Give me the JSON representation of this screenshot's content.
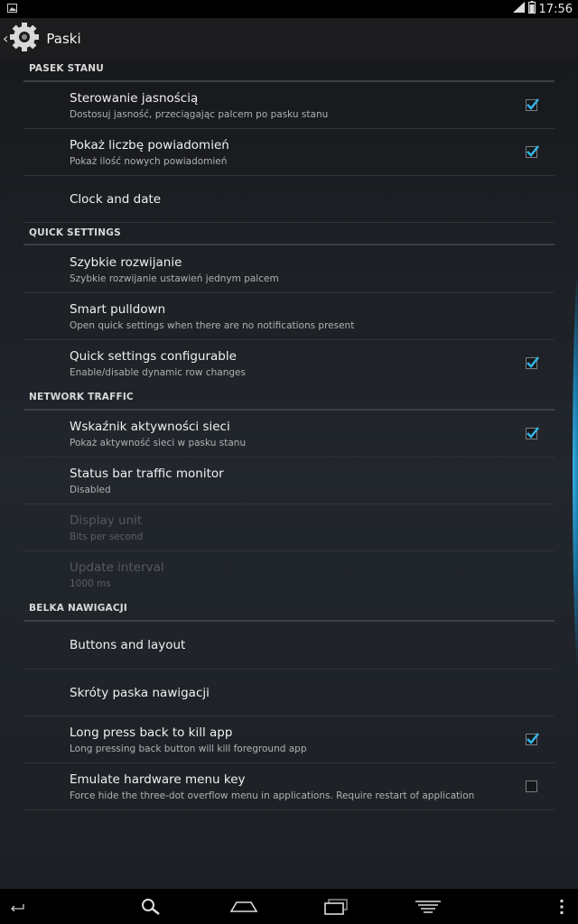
{
  "status_bar": {
    "time": "17:56"
  },
  "action_bar": {
    "title": "Paski"
  },
  "sections": [
    {
      "header": "PASEK STANU",
      "items": [
        {
          "title": "Sterowanie jasnością",
          "summary": "Dostosuj jasność, przeciągając palcem po pasku stanu",
          "checkbox": true,
          "checked": true
        },
        {
          "title": "Pokaż liczbę powiadomień",
          "summary": "Pokaż ilość nowych powiadomień",
          "checkbox": true,
          "checked": true
        },
        {
          "title": "Clock and date"
        }
      ]
    },
    {
      "header": "QUICK SETTINGS",
      "items": [
        {
          "title": "Szybkie rozwijanie",
          "summary": "Szybkie rozwijanie ustawień jednym palcem"
        },
        {
          "title": "Smart pulldown",
          "summary": "Open quick settings when there are no notifications present"
        },
        {
          "title": "Quick settings configurable",
          "summary": "Enable/disable dynamic row changes",
          "checkbox": true,
          "checked": true
        }
      ]
    },
    {
      "header": "NETWORK TRAFFIC",
      "items": [
        {
          "title": "Wskaźnik aktywności sieci",
          "summary": "Pokaż aktywność sieci w pasku stanu",
          "checkbox": true,
          "checked": true
        },
        {
          "title": "Status bar traffic monitor",
          "summary": "Disabled"
        },
        {
          "title": "Display unit",
          "summary": "Bits per second",
          "disabled": true
        },
        {
          "title": "Update interval",
          "summary": "1000 ms",
          "disabled": true
        }
      ]
    },
    {
      "header": "BELKA NAWIGACJI",
      "items": [
        {
          "title": "Buttons and layout"
        },
        {
          "title": "Skróty paska nawigacji"
        },
        {
          "title": "Long press back to kill app",
          "summary": "Long pressing back button will kill foreground app",
          "checkbox": true,
          "checked": true
        },
        {
          "title": "Emulate hardware menu key",
          "summary": "Force hide the three-dot overflow menu in applications. Require restart of application",
          "checkbox": true,
          "checked": false
        }
      ]
    }
  ],
  "nav_bar": {
    "icons": [
      "back-icon",
      "search-icon",
      "home-icon",
      "recents-icon",
      "menu-icon",
      "overflow-icon"
    ]
  },
  "colors": {
    "accent": "#33b5e5",
    "background": "#1e2227"
  }
}
